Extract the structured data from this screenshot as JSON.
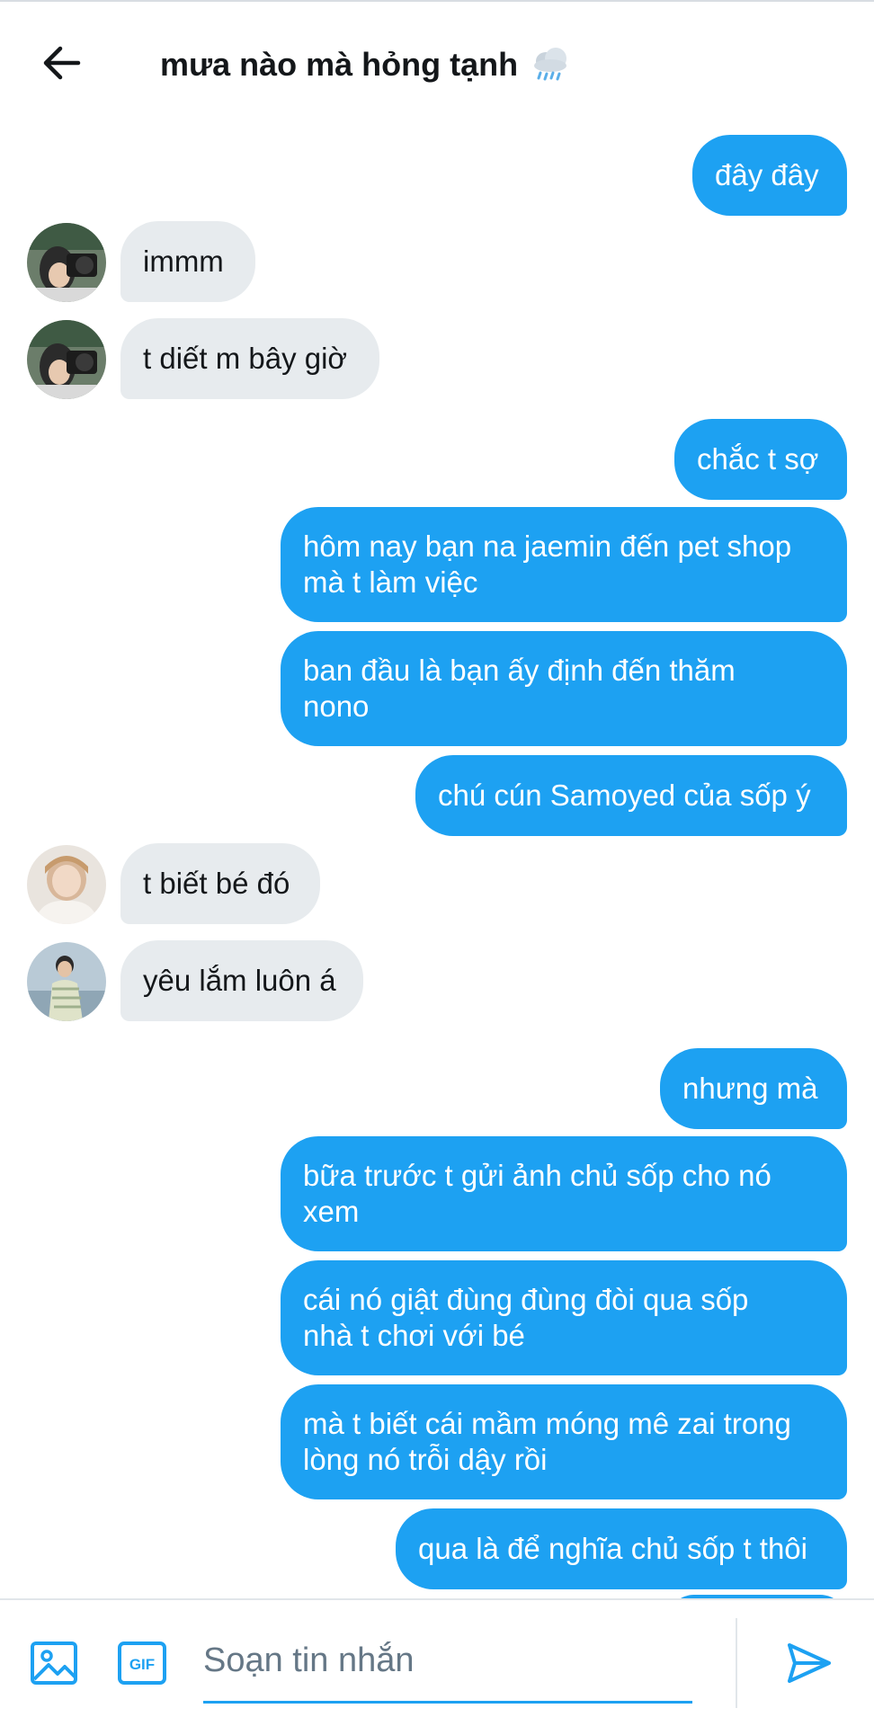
{
  "header": {
    "title": "mưa nào mà hỏng tạnh",
    "back_icon": "arrow-left-icon",
    "title_icon": "rain-cloud-icon"
  },
  "messages": [
    {
      "side": "out",
      "text": "đây đây"
    },
    {
      "side": "in",
      "text": "immm",
      "avatar": "camera-avatar"
    },
    {
      "side": "in",
      "text": "t diết m bây giờ",
      "avatar": "camera-avatar"
    },
    {
      "side": "out",
      "text": "chắc t sợ"
    },
    {
      "side": "out",
      "text": "hôm nay bạn na jaemin đến pet shop\nmà t làm việc"
    },
    {
      "side": "out",
      "text": "ban đầu là bạn ấy định đến thăm\nnono"
    },
    {
      "side": "out",
      "text": "chú cún Samoyed của sốp ý"
    },
    {
      "side": "in",
      "text": "t biết bé đó",
      "avatar": "sweater-avatar"
    },
    {
      "side": "in",
      "text": "yêu lắm luôn á",
      "avatar": "outdoor-avatar"
    },
    {
      "side": "out",
      "text": "nhưng mà"
    },
    {
      "side": "out",
      "text": "bữa trước t gửi ảnh chủ sốp cho nó\nxem"
    },
    {
      "side": "out",
      "text": "cái nó giật đùng đùng đòi qua sốp\nnhà t chơi với bé"
    },
    {
      "side": "out",
      "text": "mà t biết cái mầm móng mê zai trong\nlòng nó trỗi dậy rồi"
    },
    {
      "side": "out",
      "text": "qua là để nghĩa chủ sốp t thôi"
    }
  ],
  "composer": {
    "placeholder": "Soạn tin nhắn",
    "value": "",
    "image_icon": "image-icon",
    "gif_icon": "gif-icon",
    "gif_label": "GIF",
    "send_icon": "send-icon"
  },
  "colors": {
    "accent": "#1da1f2",
    "incoming_bubble": "#e7ebee",
    "text": "#14171a",
    "placeholder": "#657786"
  }
}
